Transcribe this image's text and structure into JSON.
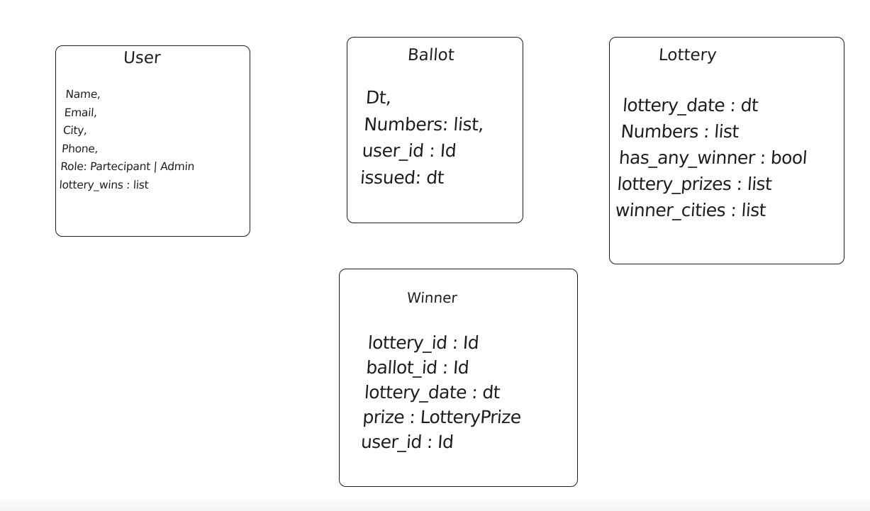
{
  "entities": {
    "user": {
      "title": "User",
      "fields": [
        "Name,",
        "Email,",
        "City,",
        "Phone,",
        "Role: Partecipant | Admin",
        "lottery_wins : list"
      ]
    },
    "ballot": {
      "title": "Ballot",
      "fields": [
        "Dt,",
        "Numbers: list,",
        "user_id : Id",
        "issued: dt"
      ]
    },
    "lottery": {
      "title": "Lottery",
      "fields": [
        "lottery_date : dt",
        "Numbers : list",
        "has_any_winner : bool",
        "lottery_prizes : list",
        "winner_cities : list"
      ]
    },
    "winner": {
      "title": "Winner",
      "fields": [
        "lottery_id : Id",
        "ballot_id : Id",
        "lottery_date : dt",
        "prize : LotteryPrize",
        "user_id : Id"
      ]
    }
  },
  "colors": {
    "stroke": "#1e1e1e",
    "background": "#ffffff"
  }
}
